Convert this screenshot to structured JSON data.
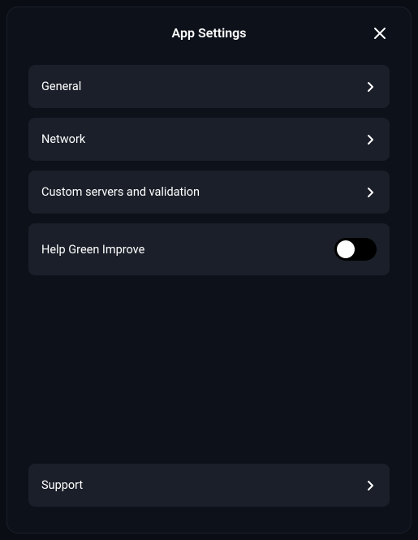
{
  "header": {
    "title": "App Settings"
  },
  "items": {
    "general": "General",
    "network": "Network",
    "custom_servers": "Custom servers and validation",
    "help_improve": "Help Green Improve",
    "support": "Support"
  },
  "toggle": {
    "help_improve_enabled": false
  }
}
